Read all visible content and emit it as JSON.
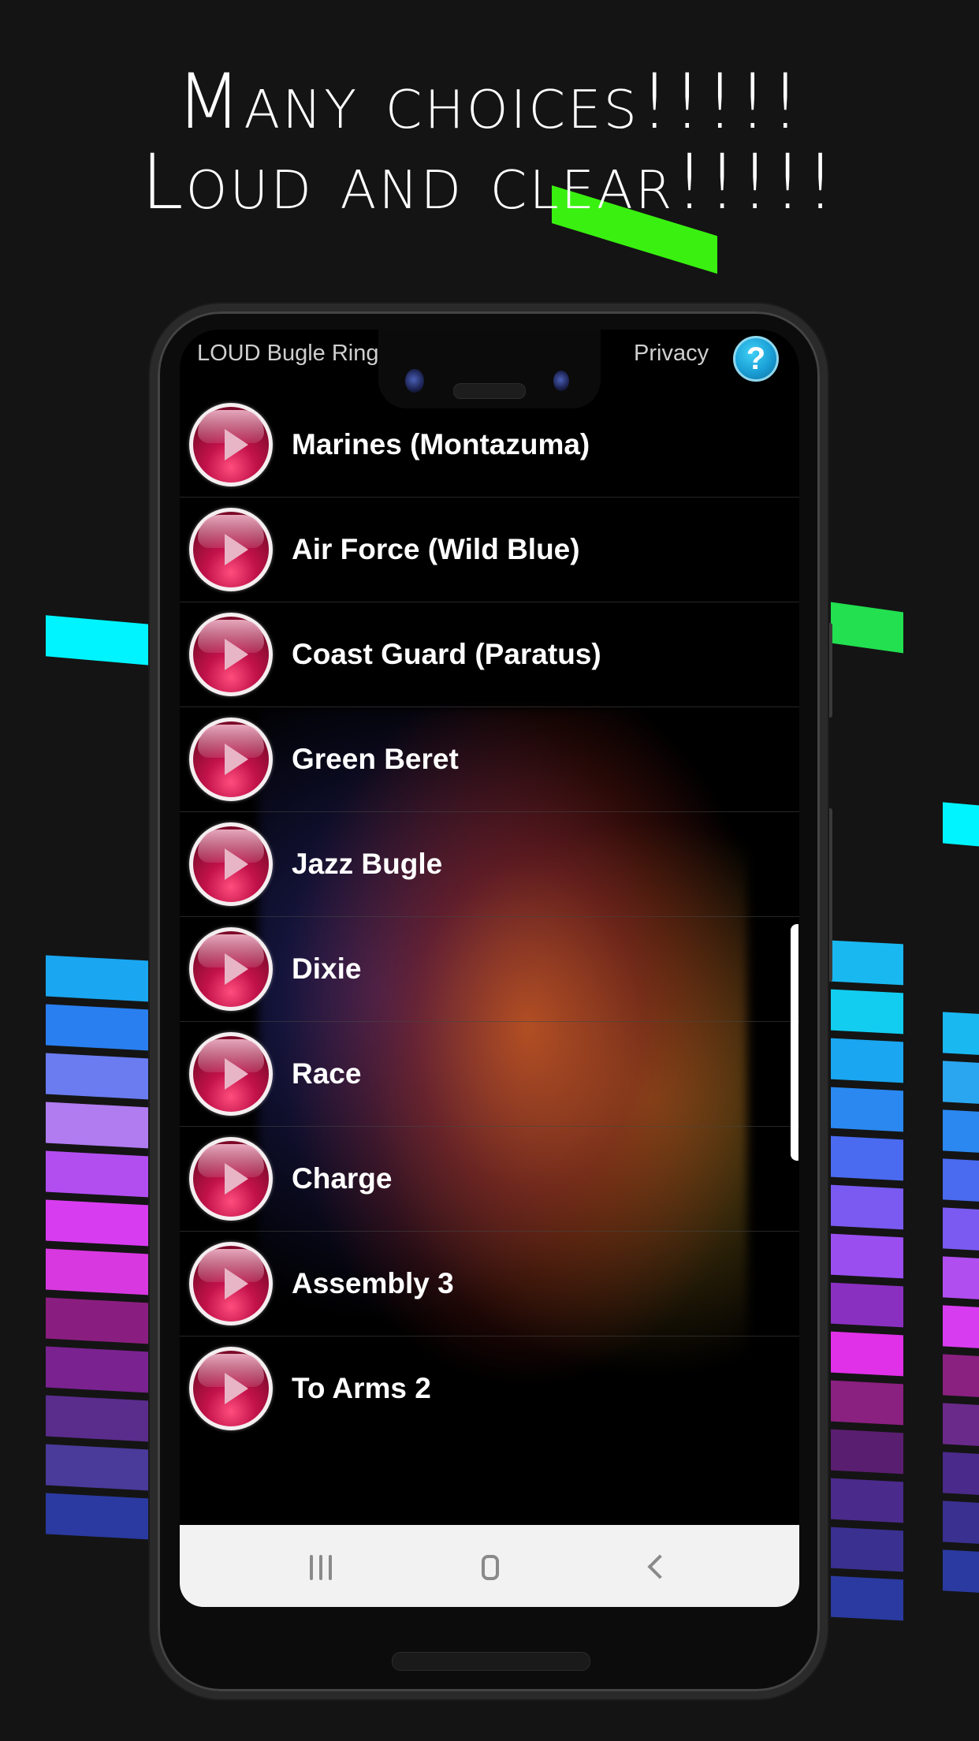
{
  "promo": {
    "headline_line1": "Many choices!!!!!",
    "headline_line2": "Loud and clear!!!!!"
  },
  "app": {
    "title": "LOUD Bugle Ring",
    "privacy_label": "Privacy",
    "help_label": "?"
  },
  "list": {
    "items": [
      {
        "label": "Marines (Montazuma)"
      },
      {
        "label": "Air Force (Wild Blue)"
      },
      {
        "label": "Coast Guard (Paratus)"
      },
      {
        "label": "Green Beret"
      },
      {
        "label": "Jazz Bugle"
      },
      {
        "label": "Dixie"
      },
      {
        "label": "Race"
      },
      {
        "label": "Charge"
      },
      {
        "label": "Assembly 3"
      },
      {
        "label": "To Arms 2"
      }
    ]
  },
  "navbar": {
    "buttons": [
      "recents",
      "home",
      "back"
    ]
  },
  "colors": {
    "background": "#141414",
    "play_button": "#c2124a",
    "help_button": "#1a9fd6",
    "navbar": "#f2f2f2",
    "accent_green": "#39f010",
    "accent_cyan": "#00f0ff"
  }
}
